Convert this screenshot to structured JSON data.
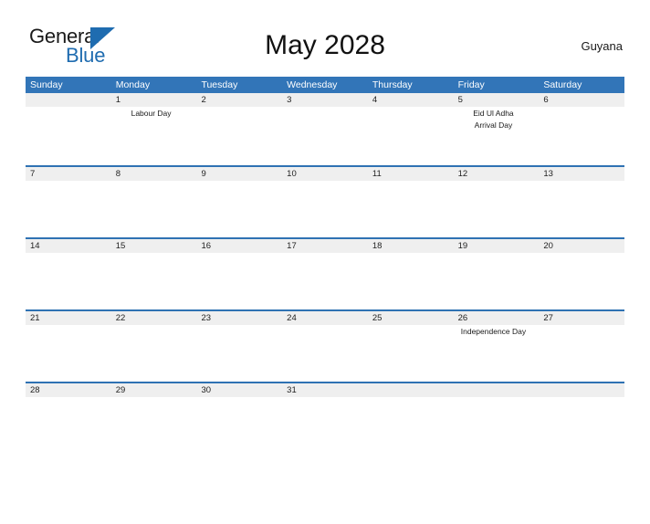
{
  "brand": {
    "name_part1": "General",
    "name_part2": "Blue",
    "accent_color": "#1f6cb0"
  },
  "header": {
    "title": "May 2028",
    "country": "Guyana"
  },
  "calendar": {
    "header_bg": "#3275b8",
    "row_band_bg": "#efefef",
    "row_divider": "#2f72b3",
    "weekdays": [
      "Sunday",
      "Monday",
      "Tuesday",
      "Wednesday",
      "Thursday",
      "Friday",
      "Saturday"
    ],
    "weeks": [
      {
        "days": [
          {
            "num": "",
            "events": []
          },
          {
            "num": "1",
            "events": [
              "Labour Day"
            ]
          },
          {
            "num": "2",
            "events": []
          },
          {
            "num": "3",
            "events": []
          },
          {
            "num": "4",
            "events": []
          },
          {
            "num": "5",
            "events": [
              "Eid Ul Adha",
              "Arrival Day"
            ]
          },
          {
            "num": "6",
            "events": []
          }
        ]
      },
      {
        "days": [
          {
            "num": "7",
            "events": []
          },
          {
            "num": "8",
            "events": []
          },
          {
            "num": "9",
            "events": []
          },
          {
            "num": "10",
            "events": []
          },
          {
            "num": "11",
            "events": []
          },
          {
            "num": "12",
            "events": []
          },
          {
            "num": "13",
            "events": []
          }
        ]
      },
      {
        "days": [
          {
            "num": "14",
            "events": []
          },
          {
            "num": "15",
            "events": []
          },
          {
            "num": "16",
            "events": []
          },
          {
            "num": "17",
            "events": []
          },
          {
            "num": "18",
            "events": []
          },
          {
            "num": "19",
            "events": []
          },
          {
            "num": "20",
            "events": []
          }
        ]
      },
      {
        "days": [
          {
            "num": "21",
            "events": []
          },
          {
            "num": "22",
            "events": []
          },
          {
            "num": "23",
            "events": []
          },
          {
            "num": "24",
            "events": []
          },
          {
            "num": "25",
            "events": []
          },
          {
            "num": "26",
            "events": [
              "Independence Day"
            ]
          },
          {
            "num": "27",
            "events": []
          }
        ]
      },
      {
        "days": [
          {
            "num": "28",
            "events": []
          },
          {
            "num": "29",
            "events": []
          },
          {
            "num": "30",
            "events": []
          },
          {
            "num": "31",
            "events": []
          },
          {
            "num": "",
            "events": []
          },
          {
            "num": "",
            "events": []
          },
          {
            "num": "",
            "events": []
          }
        ]
      }
    ]
  }
}
